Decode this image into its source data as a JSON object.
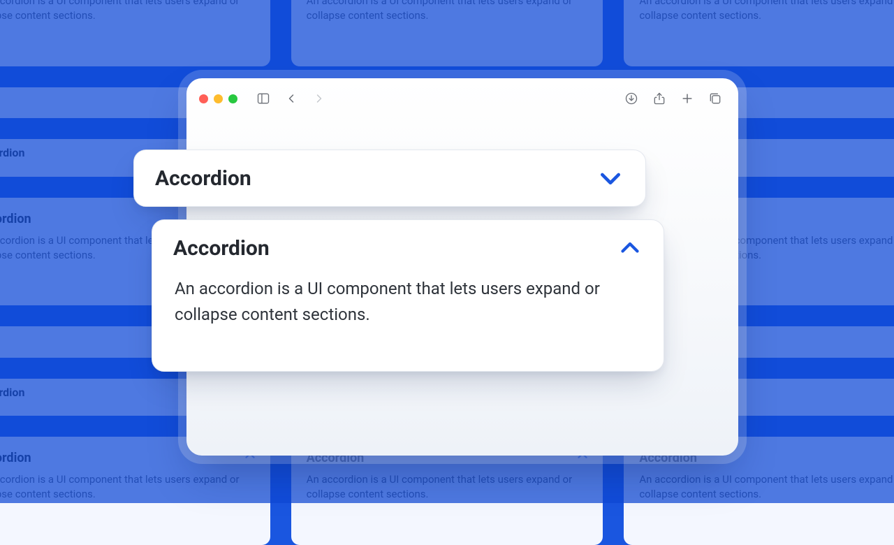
{
  "colors": {
    "accent": "#1a56e0",
    "bgOverlay": "rgba(14,72,214,0.72)"
  },
  "bg_tile": {
    "title": "Accordion",
    "body": "An accordion is a UI component that lets users expand or collapse content sections."
  },
  "browser": {
    "icons": {
      "sidebar": "sidebar-icon",
      "back": "chevron-left-icon",
      "forward": "chevron-right-icon",
      "downloads": "download-icon",
      "share": "share-icon",
      "newTab": "plus-icon",
      "tabs": "tabs-icon"
    }
  },
  "accordion": {
    "collapsed": {
      "title": "Accordion",
      "chevron": "chevron-down-icon"
    },
    "expanded": {
      "title": "Accordion",
      "body": "An accordion is a UI component that lets users expand or collapse content sections.",
      "chevron": "chevron-up-icon"
    }
  }
}
